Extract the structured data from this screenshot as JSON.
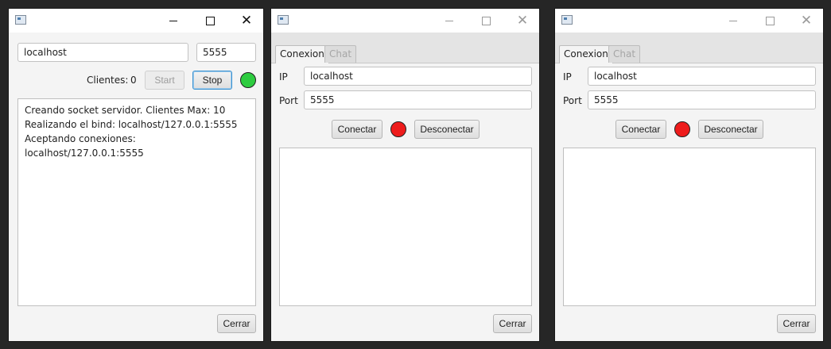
{
  "server": {
    "host_value": "localhost",
    "port_value": "5555",
    "clients_label": "Clientes:",
    "clients_count": "0",
    "start_label": "Start",
    "stop_label": "Stop",
    "status_color": "#2ecc40",
    "log": [
      "Creando socket servidor. Clientes Max: 10",
      "Realizando el bind: localhost/127.0.0.1:5555",
      "Aceptando conexiones: localhost/127.0.0.1:5555"
    ],
    "close_label": "Cerrar"
  },
  "clients": [
    {
      "tabs": [
        "Conexion",
        "Chat"
      ],
      "ip_label": "IP",
      "ip_value": "localhost",
      "port_label": "Port",
      "port_value": "5555",
      "connect_label": "Conectar",
      "disconnect_label": "Desconectar",
      "status_color": "#ee1c1c",
      "close_label": "Cerrar"
    },
    {
      "tabs": [
        "Conexion",
        "Chat"
      ],
      "ip_label": "IP",
      "ip_value": "localhost",
      "port_label": "Port",
      "port_value": "5555",
      "connect_label": "Conectar",
      "disconnect_label": "Desconectar",
      "status_color": "#ee1c1c",
      "close_label": "Cerrar"
    }
  ],
  "titlebar": {
    "close_glyph": "✕"
  }
}
